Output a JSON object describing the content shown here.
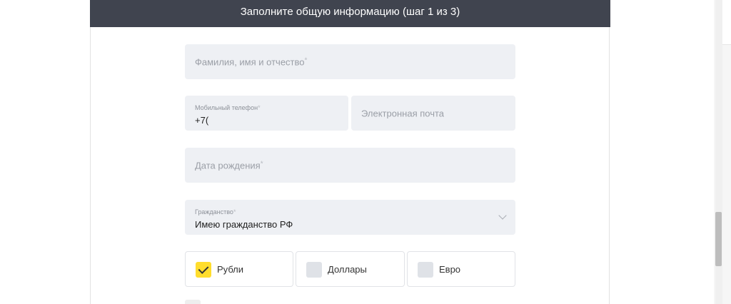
{
  "header": {
    "title": "Заполните общую информацию (шаг 1 из 3)"
  },
  "form": {
    "full_name": {
      "placeholder": "Фамилия, имя и отчество",
      "required_mark": "*"
    },
    "phone": {
      "label": "Мобильный телефон",
      "required_mark": "*",
      "value": "+7("
    },
    "email": {
      "placeholder": "Электронная почта"
    },
    "birth_date": {
      "placeholder": "Дата рождения",
      "required_mark": "*"
    },
    "citizenship": {
      "label": "Гражданство",
      "required_mark": "*",
      "value": "Имею гражданство РФ",
      "icon": "chevron-down-icon"
    },
    "currencies": [
      {
        "label": "Рубли",
        "checked": true
      },
      {
        "label": "Доллары",
        "checked": false
      },
      {
        "label": "Евро",
        "checked": false
      }
    ]
  },
  "colors": {
    "header_bg": "#40444f",
    "field_bg": "#eef0f4",
    "accent_yellow": "#ffdd2d"
  }
}
